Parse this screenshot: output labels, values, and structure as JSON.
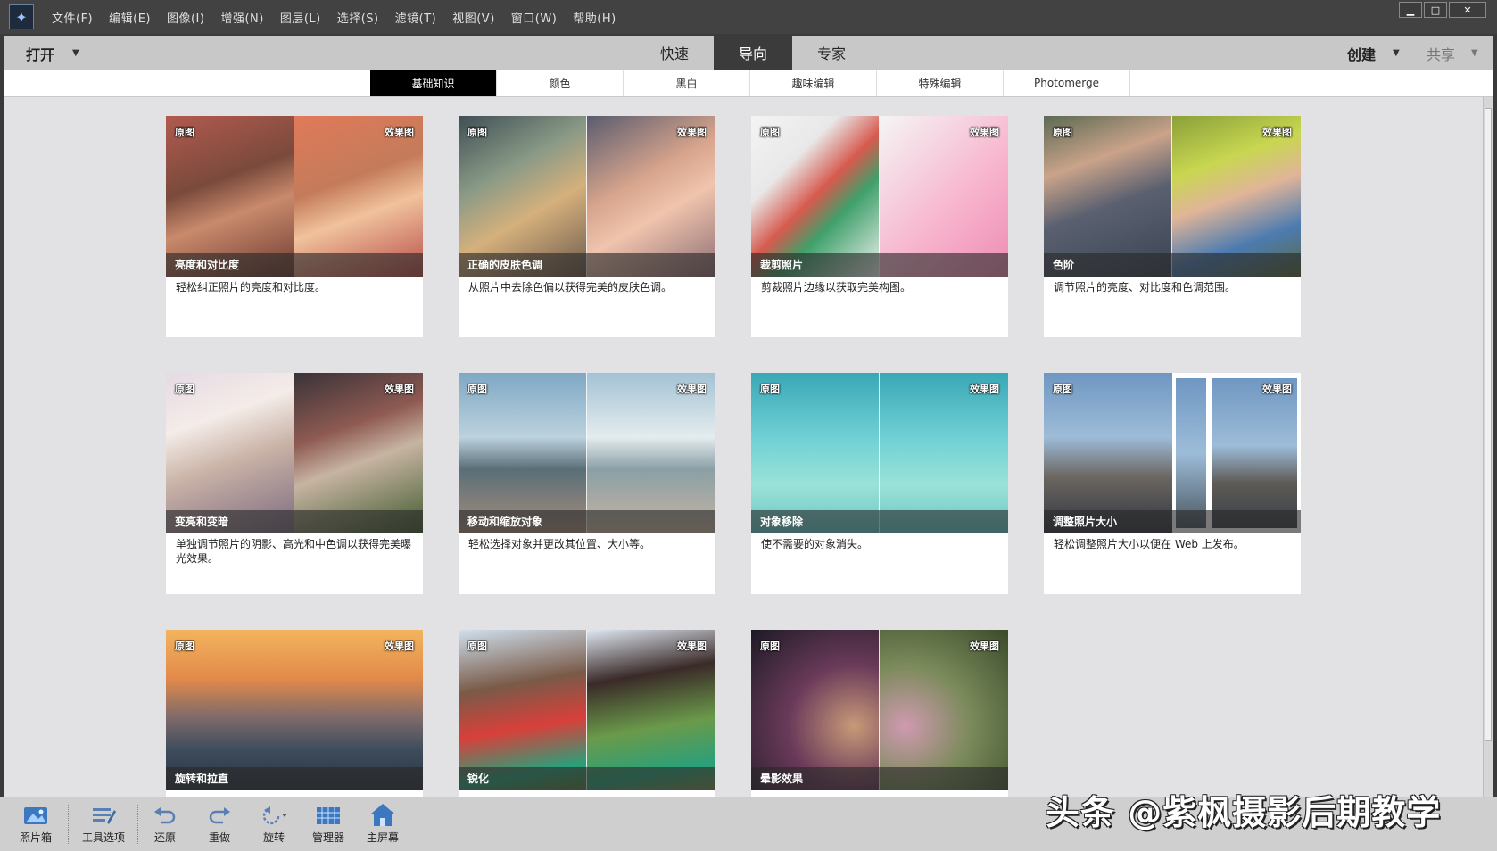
{
  "menubar": {
    "items": [
      "文件(F)",
      "编辑(E)",
      "图像(I)",
      "增强(N)",
      "图层(L)",
      "选择(S)",
      "滤镜(T)",
      "视图(V)",
      "窗口(W)",
      "帮助(H)"
    ],
    "window_controls": {
      "minimize": "▁",
      "maximize": "□",
      "close": "✕"
    }
  },
  "toolbar": {
    "open_label": "打开",
    "modes": [
      {
        "label": "快速",
        "active": false
      },
      {
        "label": "导向",
        "active": true
      },
      {
        "label": "专家",
        "active": false
      }
    ],
    "create_label": "创建",
    "share_label": "共享"
  },
  "tabs": [
    {
      "label": "基础知识",
      "active": true
    },
    {
      "label": "颜色",
      "active": false
    },
    {
      "label": "黑白",
      "active": false
    },
    {
      "label": "趣味编辑",
      "active": false
    },
    {
      "label": "特殊编辑",
      "active": false
    },
    {
      "label": "Photomerge",
      "active": false
    }
  ],
  "badges": {
    "before": "原图",
    "after": "效果图"
  },
  "cards": [
    {
      "title": "亮度和对比度",
      "desc": "轻松纠正照片的亮度和对比度。"
    },
    {
      "title": "正确的皮肤色调",
      "desc": "从照片中去除色偏以获得完美的皮肤色调。"
    },
    {
      "title": "裁剪照片",
      "desc": "剪裁照片边缘以获取完美构图。"
    },
    {
      "title": "色阶",
      "desc": "调节照片的亮度、对比度和色调范围。"
    },
    {
      "title": "变亮和变暗",
      "desc": "单独调节照片的阴影、高光和中色调以获得完美曝光效果。"
    },
    {
      "title": "移动和缩放对象",
      "desc": "轻松选择对象并更改其位置、大小等。"
    },
    {
      "title": "对象移除",
      "desc": "使不需要的对象消失。"
    },
    {
      "title": "调整照片大小",
      "desc": "轻松调整照片大小以便在 Web 上发布。"
    },
    {
      "title": "旋转和拉直",
      "desc": ""
    },
    {
      "title": "锐化",
      "desc": ""
    },
    {
      "title": "晕影效果",
      "desc": ""
    }
  ],
  "bottombar": {
    "buttons": [
      "照片箱",
      "工具选项",
      "还原",
      "重做",
      "旋转",
      "管理器",
      "主屏幕"
    ]
  },
  "watermark": "头条 @紫枫摄影后期教学"
}
